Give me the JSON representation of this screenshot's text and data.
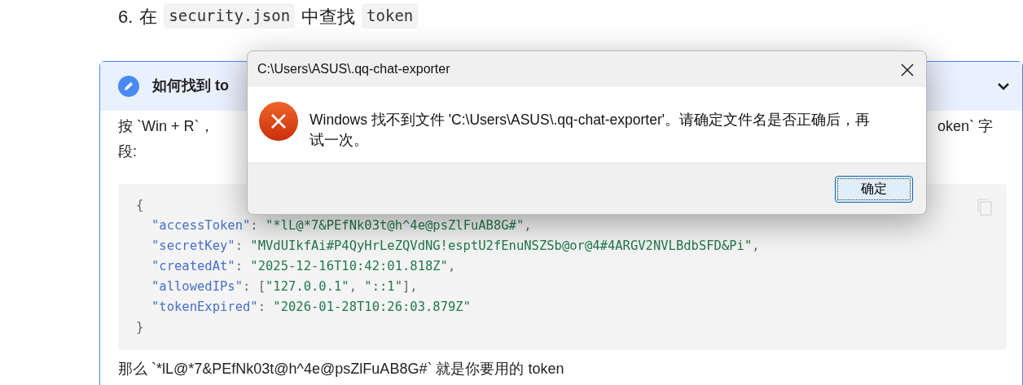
{
  "heading": {
    "number": "6.",
    "parts": [
      {
        "kind": "text",
        "text": "在"
      },
      {
        "kind": "code",
        "text": "security.json"
      },
      {
        "kind": "text",
        "text": "中查找"
      },
      {
        "kind": "code",
        "text": "token"
      }
    ]
  },
  "callout": {
    "title": "如何找到 to",
    "expanded": true,
    "paragraph_left": "按 `Win + R`，",
    "paragraph_right": "oken` 字",
    "paragraph_line2": "段:",
    "code_lines": [
      [
        {
          "kind": "punct",
          "text": "{"
        }
      ],
      [
        {
          "kind": "key",
          "text": "\"accessToken\""
        },
        {
          "kind": "punct",
          "text": ": "
        },
        {
          "kind": "string",
          "text": "\"*lL@*7&PEfNk03t@h^4e@psZlFuAB8G#\""
        },
        {
          "kind": "punct",
          "text": ","
        }
      ],
      [
        {
          "kind": "key",
          "text": "\"secretKey\""
        },
        {
          "kind": "punct",
          "text": ": "
        },
        {
          "kind": "string",
          "text": "\"MVdUIkfAi#P4QyHrLeZQVdNG!esptU2fEnuNSZSb@or@4#4ARGV2NVLBdbSFD&Pi\""
        },
        {
          "kind": "punct",
          "text": ","
        }
      ],
      [
        {
          "kind": "key",
          "text": "\"createdAt\""
        },
        {
          "kind": "punct",
          "text": ": "
        },
        {
          "kind": "string",
          "text": "\"2025-12-16T10:42:01.818Z\""
        },
        {
          "kind": "punct",
          "text": ","
        }
      ],
      [
        {
          "kind": "key",
          "text": "\"allowedIPs\""
        },
        {
          "kind": "punct",
          "text": ": ["
        },
        {
          "kind": "string",
          "text": "\"127.0.0.1\""
        },
        {
          "kind": "punct",
          "text": ", "
        },
        {
          "kind": "string",
          "text": "\"::1\""
        },
        {
          "kind": "punct",
          "text": "],"
        }
      ],
      [
        {
          "kind": "key",
          "text": "\"tokenExpired\""
        },
        {
          "kind": "punct",
          "text": ": "
        },
        {
          "kind": "string",
          "text": "\"2026-01-28T10:26:03.879Z\""
        }
      ],
      [
        {
          "kind": "punct",
          "text": "}"
        }
      ]
    ],
    "footer_text": "那么 `*lL@*7&PEfNk03t@h^4e@psZlFuAB8G#` 就是你要用的 token"
  },
  "dialog": {
    "title": "C:\\Users\\ASUS\\.qq-chat-exporter",
    "message": "Windows 找不到文件 'C:\\Users\\ASUS\\.qq-chat-exporter'。请确定文件名是否正确后，再试一次。",
    "buttons": [
      {
        "label": "确定",
        "selected": true
      }
    ]
  }
}
